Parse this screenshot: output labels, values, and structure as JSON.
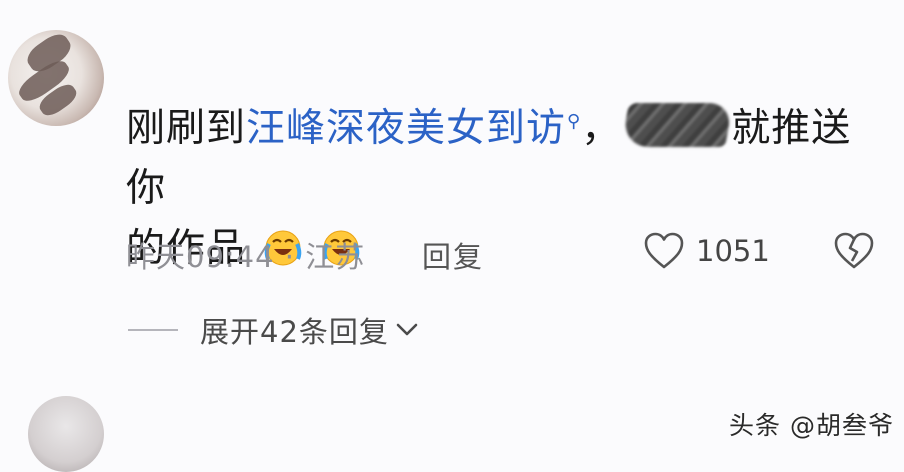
{
  "comment": {
    "prefix": "刚刷到",
    "topic": "汪峰深夜美女到访",
    "comma": "，",
    "suffix_line1": "就推送你",
    "line2": "的作品"
  },
  "meta": {
    "time_location": "昨天09:44 · 江苏",
    "reply_label": "回复",
    "like_count": "1051"
  },
  "thread": {
    "expand_label": "展开42条回复"
  },
  "watermark": "头条 @胡叁爷",
  "icons": {
    "search": "search-icon",
    "like": "heart-icon",
    "dislike": "broken-heart-icon",
    "expand": "chevron-down-icon",
    "emoji": "laughing-crying-emoji"
  }
}
